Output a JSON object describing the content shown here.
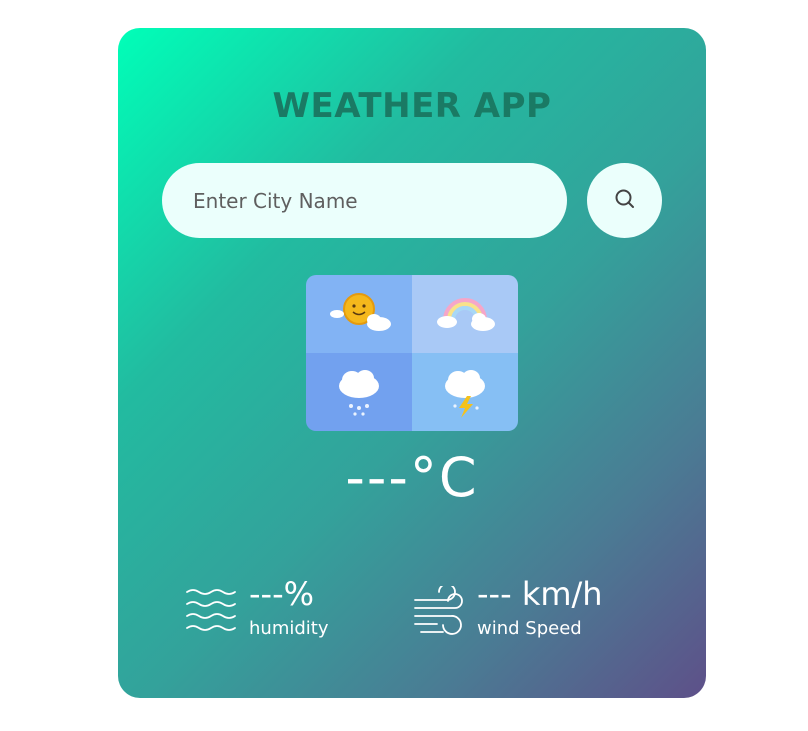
{
  "app": {
    "title": "WEATHER APP"
  },
  "search": {
    "placeholder": "Enter City Name",
    "value": ""
  },
  "icons": {
    "search": "search-icon",
    "weather": [
      "sun-cloud-icon",
      "rainbow-cloud-icon",
      "rain-cloud-icon",
      "thunder-cloud-icon"
    ],
    "humidity": "humidity-waves-icon",
    "wind": "wind-icon"
  },
  "weather": {
    "temperature": "---°C",
    "humidity_value": "---%",
    "humidity_label": "humidity",
    "wind_value": "--- km/h",
    "wind_label": "wind Speed"
  },
  "colors": {
    "gradient_start": "#00ffb8",
    "gradient_end": "#5e5089",
    "title": "#1a7a64",
    "input_bg": "#ebfffc",
    "text_light": "#ffffff"
  }
}
